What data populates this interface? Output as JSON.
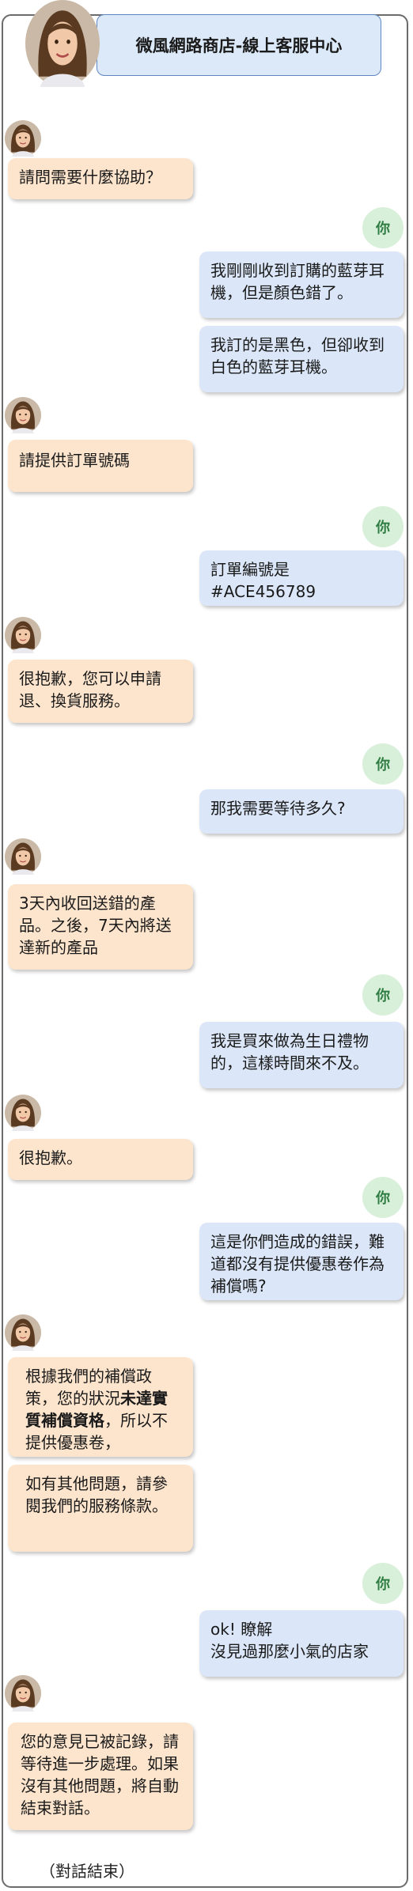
{
  "header": {
    "title": "微風網路商店-線上客服中心"
  },
  "user_badge_label": "你",
  "messages": {
    "m1": "請問需要什麼協助？",
    "m2": "我剛剛收到訂購的藍芽耳機，但是顏色錯了。",
    "m3": "我訂的是黑色，但卻收到白色的藍芽耳機。",
    "m4": "請提供訂單號碼",
    "m5": "訂單編號是\n#ACE456789",
    "m6": "很抱歉，您可以申請退、換貨服務。",
    "m7": "那我需要等待多久?",
    "m8": "3天內收回送錯的產品。之後，7天內將送達新的產品",
    "m9": "我是買來做為生日禮物的，這樣時間來不及。",
    "m10": "很抱歉。",
    "m11": "這是你們造成的錯誤，難道都沒有提供優惠卷作為補償嗎?",
    "m12_a": "根據我們的補償政策，您的狀況",
    "m12_b": "未達實質補償資格",
    "m12_c": "，所以不提供優惠卷，",
    "m13": "如有其他問題，請參閱我們的服務條款。",
    "m14": "ok! 瞭解\n沒見過那麼小氣的店家",
    "m15": "您的意見已被記錄，請等待進一步處理。如果沒有其他問題，將自動結束對話。"
  },
  "footer": {
    "end_note": "（對話結束）"
  },
  "colors": {
    "bot_bubble": "#fde5cd",
    "user_bubble": "#dbe7f8",
    "user_badge": "#d8efd9",
    "header_box": "#dce9f9"
  }
}
